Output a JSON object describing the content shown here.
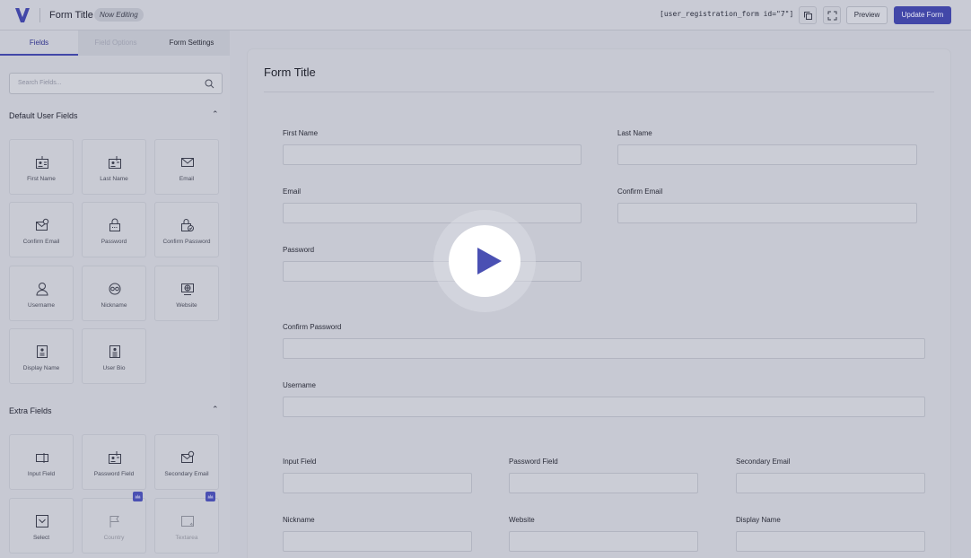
{
  "topbar": {
    "title": "Form Title",
    "badge": "Now Editing",
    "shortcode": "[user_registration_form id=\"7\"]",
    "preview_label": "Preview",
    "update_label": "Update Form"
  },
  "sidebar": {
    "tabs": [
      "Fields",
      "Field Options",
      "Form Settings"
    ],
    "search_placeholder": "Search Fields...",
    "sections": [
      {
        "title": "Default User Fields",
        "fields": [
          {
            "label": "First Name",
            "icon": "first-name-icon"
          },
          {
            "label": "Last Name",
            "icon": "last-name-icon"
          },
          {
            "label": "Email",
            "icon": "email-icon"
          },
          {
            "label": "Confirm Email",
            "icon": "confirm-email-icon"
          },
          {
            "label": "Password",
            "icon": "password-icon"
          },
          {
            "label": "Confirm Password",
            "icon": "confirm-password-icon"
          },
          {
            "label": "Username",
            "icon": "username-icon"
          },
          {
            "label": "Nickname",
            "icon": "nickname-icon"
          },
          {
            "label": "Website",
            "icon": "website-icon"
          },
          {
            "label": "Display Name",
            "icon": "display-name-icon"
          },
          {
            "label": "User Bio",
            "icon": "user-bio-icon"
          }
        ]
      },
      {
        "title": "Extra Fields",
        "fields": [
          {
            "label": "Input Field",
            "icon": "input-field-icon"
          },
          {
            "label": "Password Field",
            "icon": "password-field-icon"
          },
          {
            "label": "Secondary Email",
            "icon": "secondary-email-icon"
          },
          {
            "label": "Select",
            "icon": "select-icon"
          },
          {
            "label": "Country",
            "icon": "country-flag-icon",
            "pro": true
          },
          {
            "label": "Textarea",
            "icon": "textarea-icon",
            "pro": true
          }
        ]
      }
    ]
  },
  "form": {
    "title": "Form Title",
    "fields": {
      "first_name": "First Name",
      "last_name": "Last Name",
      "email": "Email",
      "confirm_email": "Confirm Email",
      "password": "Password",
      "confirm_password": "Confirm Password",
      "username": "Username",
      "input_field": "Input Field",
      "password_field": "Password Field",
      "secondary_email": "Secondary Email",
      "nickname": "Nickname",
      "website": "Website",
      "display_name": "Display Name"
    }
  },
  "colors": {
    "accent": "#4247a8",
    "overlay": "#c5c7d2",
    "play": "#4a50b3"
  }
}
